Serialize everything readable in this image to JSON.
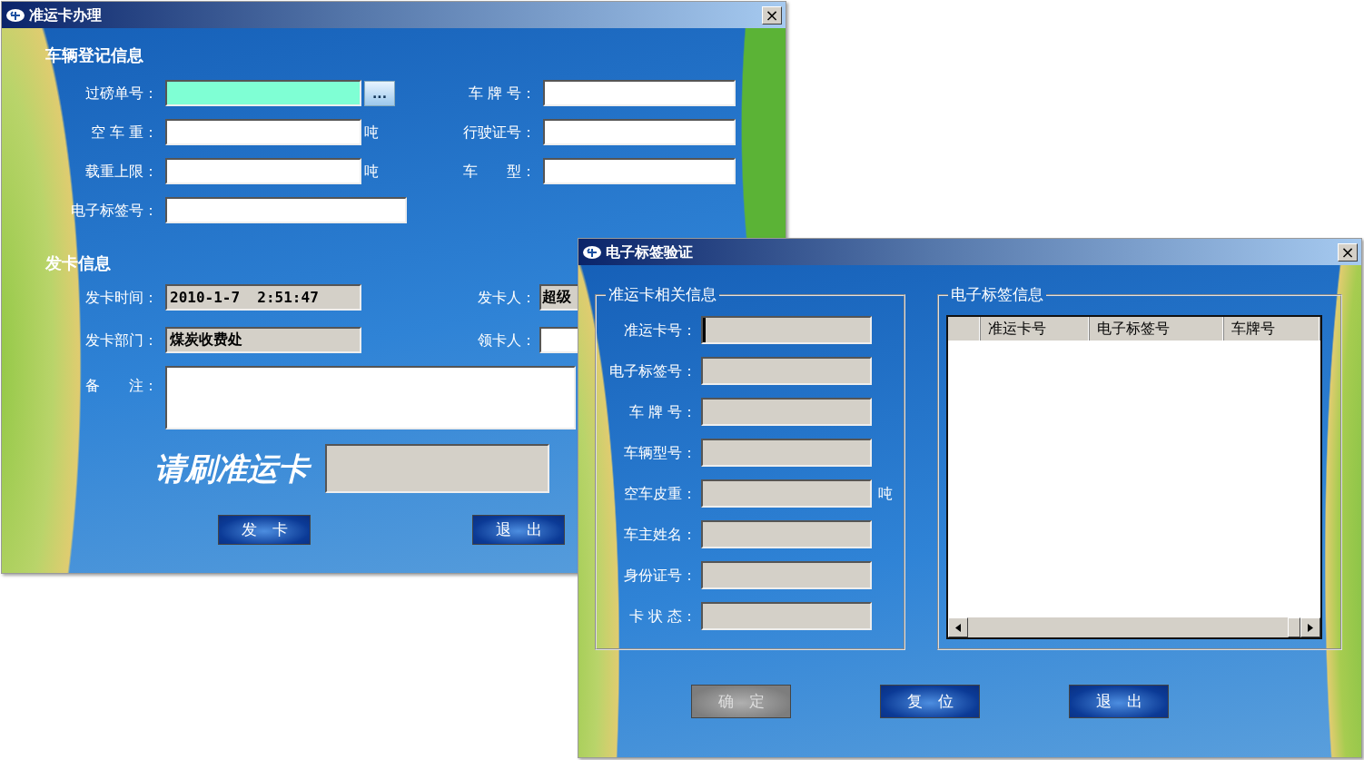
{
  "main_window": {
    "title": "准运卡办理",
    "close": "×",
    "vehicle_section": {
      "heading": "车辆登记信息",
      "fields": [
        {
          "label": "过磅单号：",
          "kind": "lookup",
          "button": "...",
          "focused": true
        },
        {
          "label": "车 牌 号：",
          "kind": "text",
          "focused": false
        },
        {
          "label": "空 车 重：",
          "kind": "text",
          "unit": "吨",
          "focused": false
        },
        {
          "label": "行驶证号：",
          "kind": "text",
          "focused": false
        },
        {
          "label": "载重上限：",
          "kind": "text",
          "unit": "吨",
          "focused": false
        },
        {
          "label": "车　　型：",
          "kind": "text",
          "focused": false
        },
        {
          "label": "电子标签号：",
          "kind": "wide",
          "focused": false
        }
      ]
    },
    "card_section": {
      "heading": "发卡信息",
      "fields": [
        {
          "label": "发卡时间：",
          "value": "2010-1-7  2:51:47",
          "readonly": true
        },
        {
          "label": "发卡人：",
          "value": "超级",
          "readonly": true
        },
        {
          "label": "发卡部门：",
          "value": "煤炭收费处",
          "readonly": true
        },
        {
          "label": "领卡人：",
          "readonly": false
        }
      ],
      "remark_label": "备　　注：",
      "swipe_prompt": "请刷准运卡"
    },
    "buttons": [
      {
        "label": "发　卡",
        "disabled": false
      },
      {
        "label": "退　出",
        "disabled": false
      }
    ]
  },
  "verify_window": {
    "title": "电子标签验证",
    "close": "×",
    "card_group": {
      "heading": "准运卡相关信息",
      "fields": [
        {
          "label": "准运卡号：",
          "focused": true
        },
        {
          "label": "电子标签号：",
          "focused": false
        },
        {
          "label": "车 牌 号：",
          "focused": false
        },
        {
          "label": "车辆型号：",
          "focused": false
        },
        {
          "label": "空车皮重：",
          "unit": "吨",
          "focused": false
        },
        {
          "label": "车主姓名：",
          "focused": false
        },
        {
          "label": "身份证号：",
          "focused": false
        },
        {
          "label": "卡 状 态：",
          "focused": false
        }
      ]
    },
    "tag_group": {
      "heading": "电子标签信息",
      "table": {
        "columns": [
          "准运卡号",
          "电子标签号",
          "车牌号"
        ]
      }
    },
    "buttons": [
      {
        "label": "确　定",
        "disabled": true
      },
      {
        "label": "复　位",
        "disabled": false
      },
      {
        "label": "退　出",
        "disabled": false
      }
    ]
  }
}
